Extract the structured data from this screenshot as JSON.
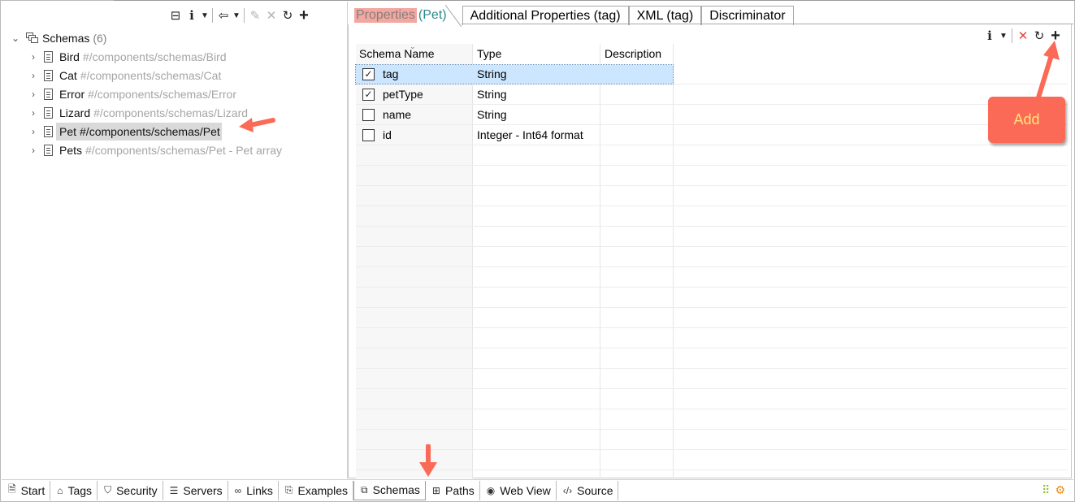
{
  "left_toolbar": {
    "icons": [
      "collapse-icon",
      "info-icon",
      "dropdown-icon",
      "export-icon",
      "dropdown-icon",
      "edit-icon",
      "delete-icon",
      "refresh-icon",
      "add-icon"
    ]
  },
  "tree": {
    "root_label": "Schemas",
    "root_count": "(6)",
    "items": [
      {
        "name": "Bird",
        "path": "#/components/schemas/Bird"
      },
      {
        "name": "Cat",
        "path": "#/components/schemas/Cat"
      },
      {
        "name": "Error",
        "path": "#/components/schemas/Error"
      },
      {
        "name": "Lizard",
        "path": "#/components/schemas/Lizard"
      },
      {
        "name": "Pet",
        "path": "#/components/schemas/Pet"
      },
      {
        "name": "Pets",
        "path": "#/components/schemas/Pet - Pet array"
      }
    ],
    "selected_index": 4
  },
  "tabs": {
    "active_label": "Properties",
    "active_sub": "(Pet)",
    "others": [
      "Additional Properties (tag)",
      "XML (tag)",
      "Discriminator"
    ]
  },
  "table": {
    "headers": [
      "Schema Name",
      "Type",
      "Description"
    ],
    "rows": [
      {
        "checked": true,
        "name": "tag",
        "type": "String",
        "description": ""
      },
      {
        "checked": true,
        "name": "petType",
        "type": "String",
        "description": ""
      },
      {
        "checked": false,
        "name": "name",
        "type": "String",
        "description": ""
      },
      {
        "checked": false,
        "name": "id",
        "type": "Integer - Int64 format",
        "description": ""
      }
    ],
    "selected_row": 0
  },
  "annotation": {
    "add_label": "Add"
  },
  "bottom_tabs": [
    {
      "label": "Start",
      "icon": "document-icon"
    },
    {
      "label": "Tags",
      "icon": "tag-icon"
    },
    {
      "label": "Security",
      "icon": "shield-icon"
    },
    {
      "label": "Servers",
      "icon": "server-icon"
    },
    {
      "label": "Links",
      "icon": "link-icon"
    },
    {
      "label": "Examples",
      "icon": "examples-icon"
    },
    {
      "label": "Schemas",
      "icon": "schemas-icon"
    },
    {
      "label": "Paths",
      "icon": "paths-icon"
    },
    {
      "label": "Web View",
      "icon": "globe-icon"
    },
    {
      "label": "Source",
      "icon": "code-icon"
    }
  ],
  "active_bottom_tab": "Schemas",
  "colors": {
    "tab_highlight": "#f3a7a0",
    "selected_row": "#cce6ff",
    "callout": "#fa6a57",
    "callout_text": "#ffe37a",
    "delete_red": "#e0473a"
  }
}
